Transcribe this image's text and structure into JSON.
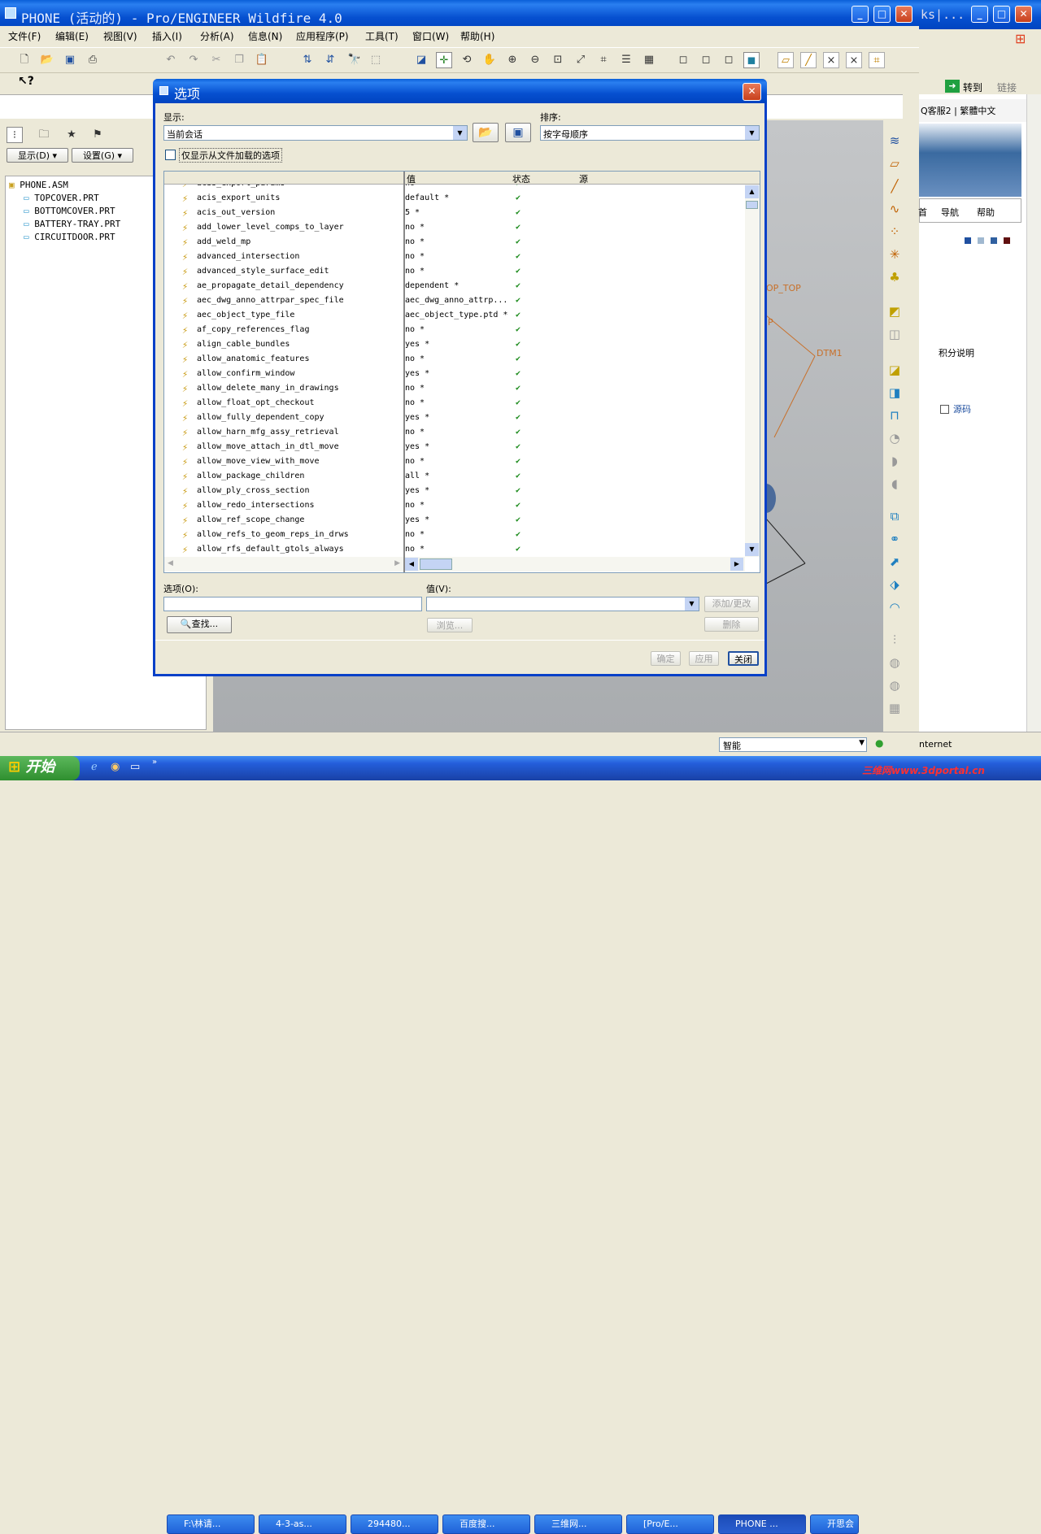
{
  "app": {
    "title": "PHONE (活动的) - Pro/ENGINEER Wildfire 4.0"
  },
  "menu": [
    "文件(F)",
    "编辑(E)",
    "视图(V)",
    "插入(I)",
    "分析(A)",
    "信息(N)",
    "应用程序(P)",
    "工具(T)",
    "窗口(W)",
    "帮助(H)"
  ],
  "left_panel": {
    "show_button": "显示(D) ▾",
    "settings_button": "设置(G) ▾",
    "tree": [
      "PHONE.ASM",
      "TOPCOVER.PRT",
      "BOTTOMCOVER.PRT",
      "BATTERY-TRAY.PRT",
      "CIRCUITDOOR.PRT"
    ]
  },
  "dialog": {
    "title": "选项",
    "display_label": "显示:",
    "display_value": "当前会话",
    "sort_label": "排序:",
    "sort_value": "按字母顺序",
    "checkbox_label": "仅显示从文件加载的选项",
    "columns": {
      "value": "值",
      "status": "状态",
      "source": "源"
    },
    "rows": [
      {
        "name": "acis_export_params",
        "value": "no *"
      },
      {
        "name": "acis_export_units",
        "value": "default *"
      },
      {
        "name": "acis_out_version",
        "value": "5 *"
      },
      {
        "name": "add_lower_level_comps_to_layer",
        "value": "no *"
      },
      {
        "name": "add_weld_mp",
        "value": "no *"
      },
      {
        "name": "advanced_intersection",
        "value": "no *"
      },
      {
        "name": "advanced_style_surface_edit",
        "value": "no *"
      },
      {
        "name": "ae_propagate_detail_dependency",
        "value": "dependent *"
      },
      {
        "name": "aec_dwg_anno_attrpar_spec_file",
        "value": "aec_dwg_anno_attrp..."
      },
      {
        "name": "aec_object_type_file",
        "value": "aec_object_type.ptd *"
      },
      {
        "name": "af_copy_references_flag",
        "value": "no *"
      },
      {
        "name": "align_cable_bundles",
        "value": "yes *"
      },
      {
        "name": "allow_anatomic_features",
        "value": "no *"
      },
      {
        "name": "allow_confirm_window",
        "value": "yes *"
      },
      {
        "name": "allow_delete_many_in_drawings",
        "value": "no *"
      },
      {
        "name": "allow_float_opt_checkout",
        "value": "no *"
      },
      {
        "name": "allow_fully_dependent_copy",
        "value": "yes *"
      },
      {
        "name": "allow_harn_mfg_assy_retrieval",
        "value": "no *"
      },
      {
        "name": "allow_move_attach_in_dtl_move",
        "value": "yes *"
      },
      {
        "name": "allow_move_view_with_move",
        "value": "no *"
      },
      {
        "name": "allow_package_children",
        "value": "all *"
      },
      {
        "name": "allow_ply_cross_section",
        "value": "yes *"
      },
      {
        "name": "allow_redo_intersections",
        "value": "no *"
      },
      {
        "name": "allow_ref_scope_change",
        "value": "yes *"
      },
      {
        "name": "allow_refs_to_geom_reps_in_drws",
        "value": "no *"
      },
      {
        "name": "allow_rfs_default_gtols_always",
        "value": "no *"
      }
    ],
    "option_label": "选项(O):",
    "value_label": "值(V):",
    "find_button": "查找...",
    "browse_button": "浏览...",
    "add_change_button": "添加/更改",
    "delete_button": "删除",
    "ok_button": "确定",
    "apply_button": "应用",
    "close_button": "关闭"
  },
  "browser": {
    "title_fragment": "ks|...",
    "goto": "转到",
    "links": "链接",
    "kefu": "Q客服2 | 繁體中文",
    "nav": [
      "首",
      "导航",
      "帮助"
    ],
    "points": "积分说明",
    "source_code": "源码",
    "status_internet": "nternet",
    "zoom_select": "智能"
  },
  "graphics": {
    "labels": [
      "OP_TOP",
      "P",
      "DTM1"
    ]
  },
  "taskbar": {
    "start": "开始",
    "items": [
      "F:\\林请...",
      "4-3-as...",
      "294480...",
      "百度搜...",
      "三维网...",
      "[Pro/E...",
      "PHONE ...",
      "开思会"
    ],
    "watermark": "三维网www.3dportal.cn"
  }
}
